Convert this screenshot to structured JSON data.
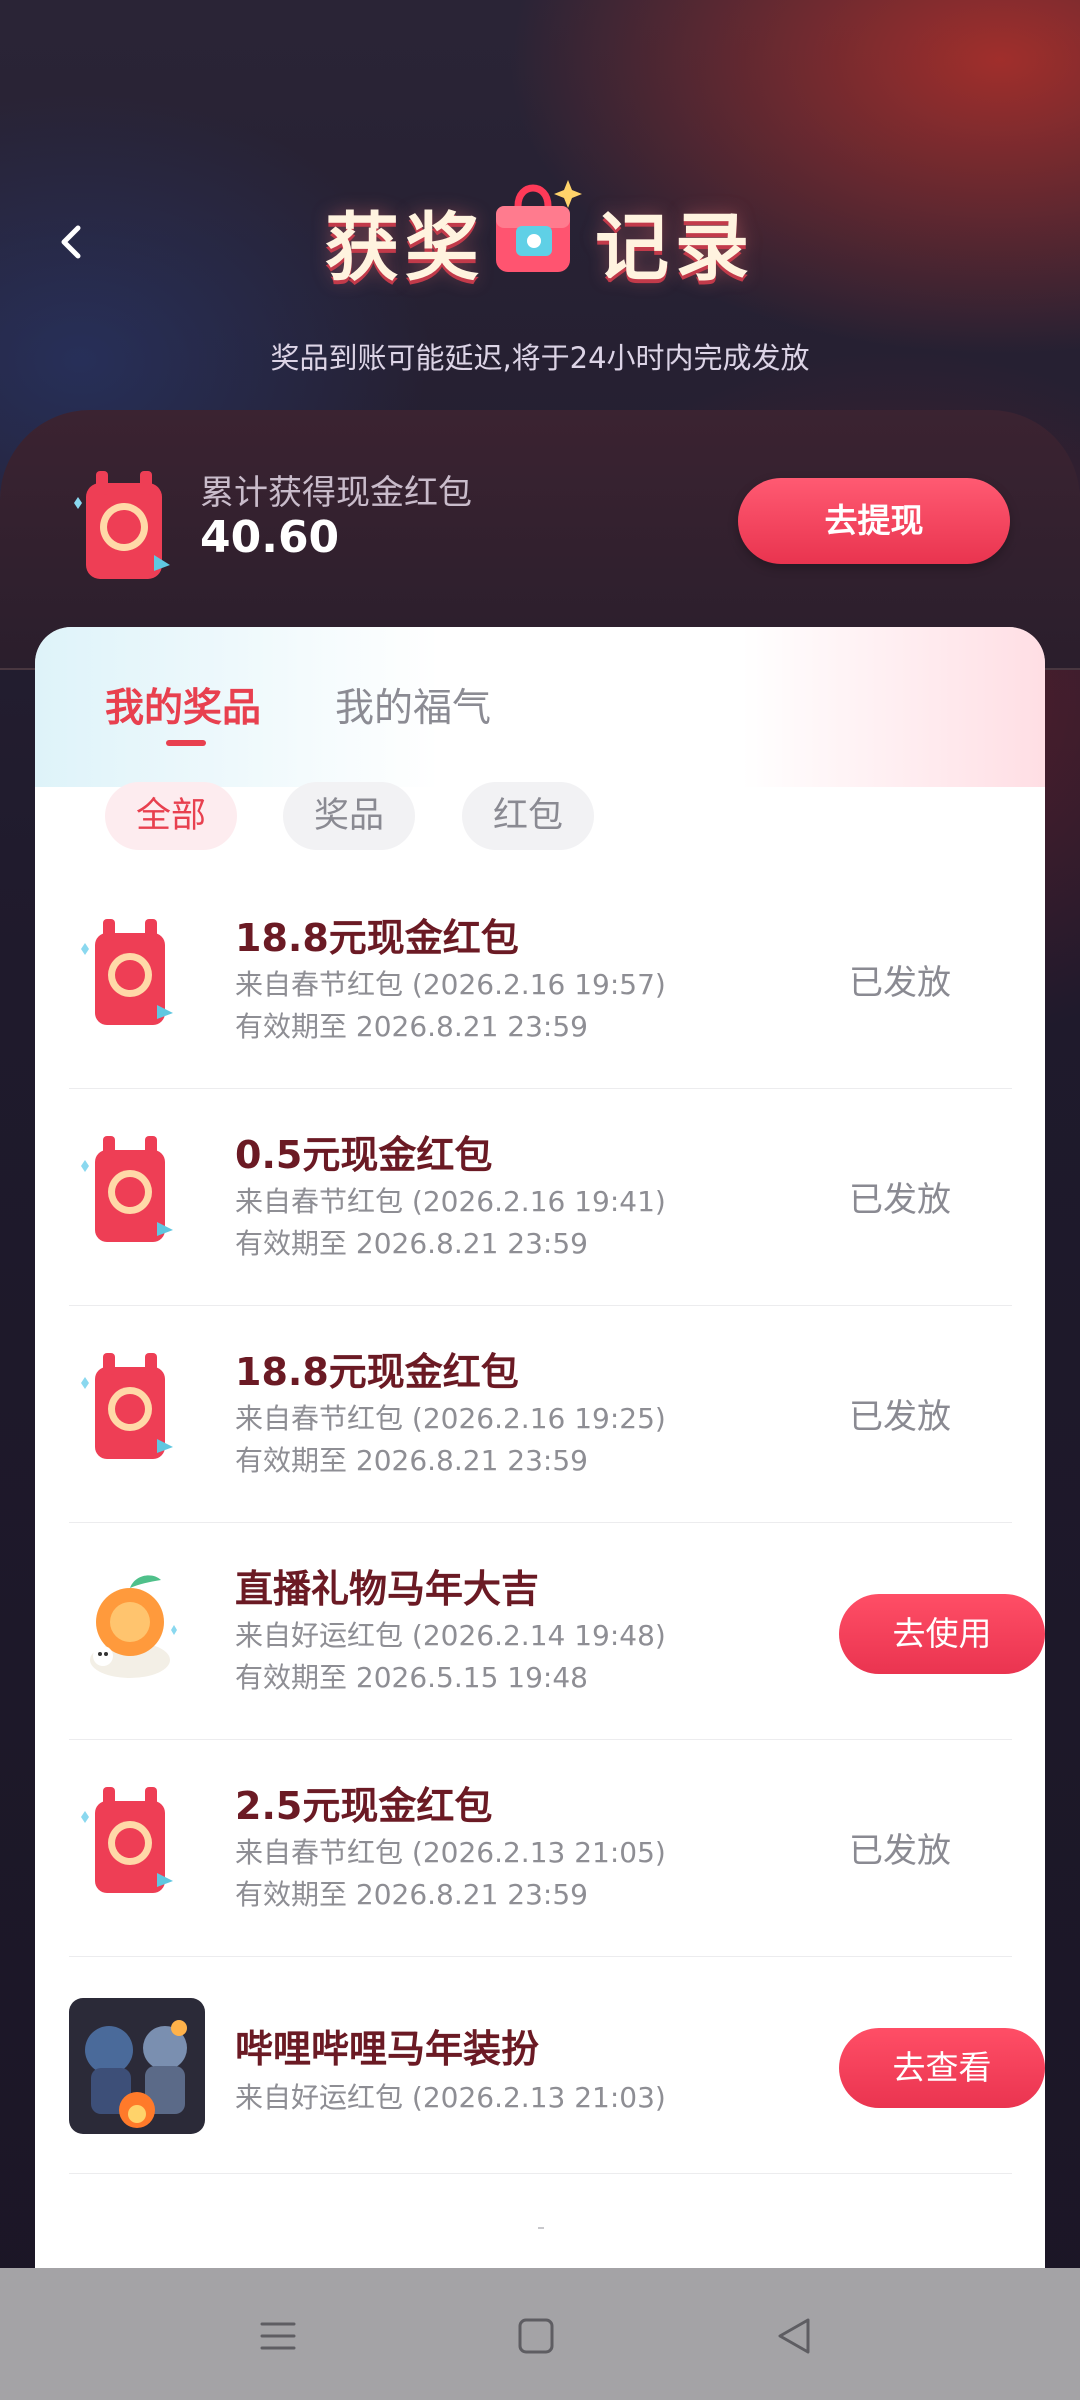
{
  "header": {
    "title_left": "获奖",
    "title_right": "记录",
    "subtitle": "奖品到账可能延迟,将于24小时内完成发放"
  },
  "summary": {
    "label": "累计获得现金红包",
    "value": "40.60",
    "withdraw_label": "去提现"
  },
  "tabs": [
    {
      "label": "我的奖品",
      "active": true
    },
    {
      "label": "我的福气",
      "active": false
    }
  ],
  "filters": [
    {
      "label": "全部",
      "active": true
    },
    {
      "label": "奖品",
      "active": false
    },
    {
      "label": "红包",
      "active": false
    }
  ],
  "records": [
    {
      "title": "18.8元现金红包",
      "source": "来自春节红包 (2026.2.16 19:57)",
      "expiry": "有效期至 2026.8.21 23:59",
      "status": "已发放",
      "icon": "red-envelope-icon"
    },
    {
      "title": "0.5元现金红包",
      "source": "来自春节红包 (2026.2.16 19:41)",
      "expiry": "有效期至 2026.8.21 23:59",
      "status": "已发放",
      "icon": "red-envelope-icon"
    },
    {
      "title": "18.8元现金红包",
      "source": "来自春节红包 (2026.2.16 19:25)",
      "expiry": "有效期至 2026.8.21 23:59",
      "status": "已发放",
      "icon": "red-envelope-icon"
    },
    {
      "title": "直播礼物马年大吉",
      "source": "来自好运红包 (2026.2.14 19:48)",
      "expiry": "有效期至 2026.5.15 19:48",
      "action": "去使用",
      "icon": "lucky-orange-gift-icon"
    },
    {
      "title": "2.5元现金红包",
      "source": "来自春节红包 (2026.2.13 21:05)",
      "expiry": "有效期至 2026.8.21 23:59",
      "status": "已发放",
      "icon": "red-envelope-icon"
    },
    {
      "title": "哔哩哔哩马年装扮",
      "source": "来自好运红包 (2026.2.13 21:03)",
      "action": "去查看",
      "icon": "costume-thumbnail-image"
    }
  ],
  "colors": {
    "accent": "#e8404f",
    "title_text": "#6b1a24",
    "muted": "#8e8e94"
  },
  "navbar": [
    "menu-icon",
    "home-square-icon",
    "back-triangle-icon"
  ]
}
